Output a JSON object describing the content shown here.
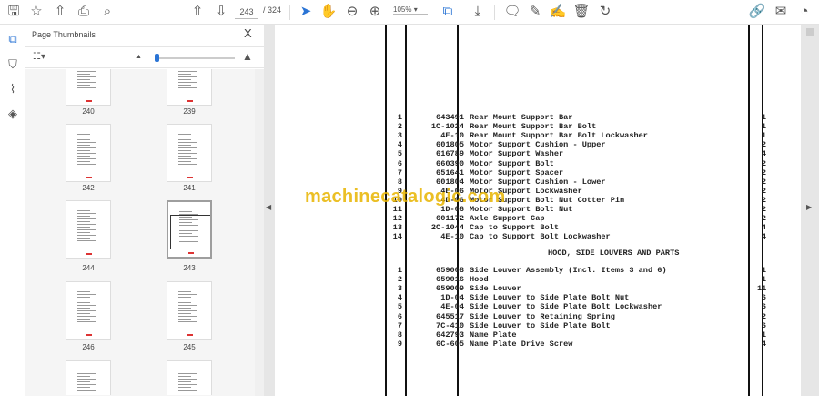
{
  "toolbar": {
    "current_page": "243",
    "total_pages": "/ 324",
    "zoom": "105%"
  },
  "panel": {
    "title": "Page Thumbnails",
    "close": "X"
  },
  "thumbnails": [
    {
      "label": "240"
    },
    {
      "label": "239"
    },
    {
      "label": "242"
    },
    {
      "label": "241"
    },
    {
      "label": "244"
    },
    {
      "label": "243",
      "selected": true
    },
    {
      "label": "246"
    },
    {
      "label": "245"
    }
  ],
  "document": {
    "watermark": "machinecatalogic.com",
    "rows_a": [
      [
        "1",
        "643491",
        "Rear Mount Support Bar",
        "1"
      ],
      [
        "2",
        "1C-1024",
        "Rear Mount Support Bar Bolt",
        "1"
      ],
      [
        "3",
        "4E-10",
        "Rear Mount Support Bar Bolt Lockwasher",
        "1"
      ],
      [
        "4",
        "601805",
        "Motor Support Cushion - Upper",
        "2"
      ],
      [
        "5",
        "616789",
        "Motor Support Washer",
        "4"
      ],
      [
        "6",
        "660390",
        "Motor Support Bolt",
        "2"
      ],
      [
        "7",
        "651641",
        "Motor Support Spacer",
        "2"
      ],
      [
        "8",
        "601804",
        "Motor Support Cushion - Lower",
        "2"
      ],
      [
        "9",
        "4E-06",
        "Motor Support Lockwasher",
        "2"
      ],
      [
        "10",
        "4D-06",
        "Motor Support Bolt Nut Cotter Pin",
        "2"
      ],
      [
        "11",
        "1D-06",
        "Motor Support Bolt Nut",
        "2"
      ],
      [
        "12",
        "601172",
        "Axle Support Cap",
        "2"
      ],
      [
        "13",
        "2C-1044",
        "Cap to Support Bolt",
        "4"
      ],
      [
        "14",
        "4E-10",
        "Cap to Support Bolt Lockwasher",
        "4"
      ]
    ],
    "section_title": "HOOD, SIDE LOUVERS AND PARTS",
    "rows_b": [
      [
        "1",
        "659008",
        "Side Louver Assembly (Incl. Items 3 and 6)",
        "1"
      ],
      [
        "2",
        "659016",
        "Hood",
        "1"
      ],
      [
        "3",
        "659009",
        "Side Louver",
        "11"
      ],
      [
        "4",
        "1D-04",
        "Side Louver to Side Plate Bolt Nut",
        "6"
      ],
      [
        "5",
        "4E-04",
        "Side Louver to Side Plate Bolt Lockwasher",
        "6"
      ],
      [
        "6",
        "645517",
        "Side Louver to Retaining Spring",
        "2"
      ],
      [
        "7",
        "7C-410",
        "Side Louver to Side Plate Bolt",
        "6"
      ],
      [
        "8",
        "642793",
        "Name Plate",
        "1"
      ],
      [
        "9",
        "6C-605",
        "Name Plate Drive Screw",
        "4"
      ]
    ]
  }
}
